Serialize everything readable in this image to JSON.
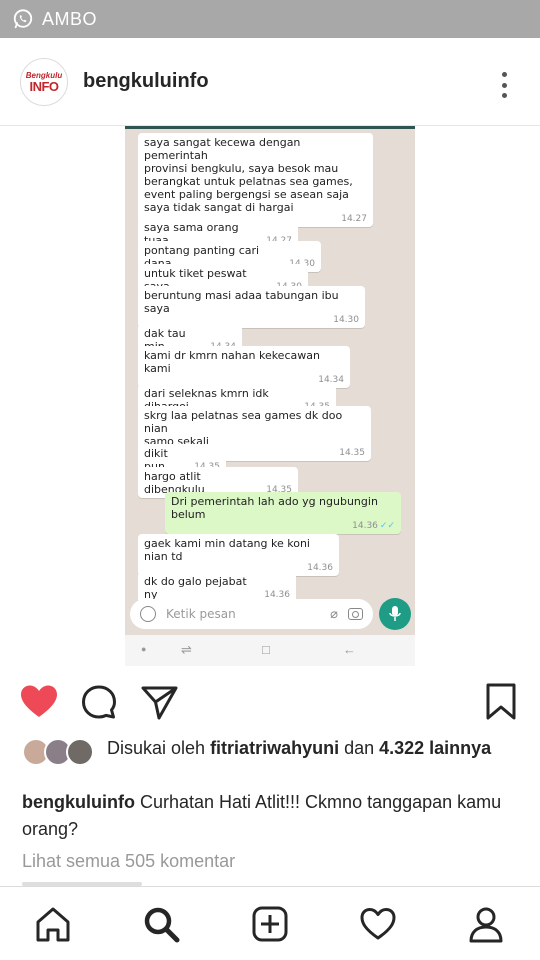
{
  "status_bar": {
    "app_name": "AMBO",
    "icon": "whatsapp-icon"
  },
  "post": {
    "username": "bengkuluinfo",
    "avatar_logo_top": "Bengkulu",
    "avatar_logo_bottom": "INFO",
    "more_icon": "more-vertical-icon"
  },
  "chat": {
    "messages": [
      {
        "text": "saya sangat kecewa dengan pemerintah\nprovinsi bengkulu, saya besok mau\nberangkat untuk pelatnas sea games,\nevent paling bergengsi se asean saja\nsaya tidak sangat di hargai",
        "time": "14.27",
        "outgoing": false
      },
      {
        "text": "saya sama orang tuaa",
        "time": "14.27",
        "outgoing": false
      },
      {
        "text": "pontang panting cari dana",
        "time": "14.30",
        "outgoing": false
      },
      {
        "text": "untuk tiket peswat saya",
        "time": "14.30",
        "outgoing": false
      },
      {
        "text": "beruntung masi adaa tabungan ibu saya",
        "time": "14.30",
        "outgoing": false
      },
      {
        "text": "dak tau min",
        "time": "14.34",
        "outgoing": false
      },
      {
        "text": "kami dr kmrn nahan kekecawan kami",
        "time": "14.34",
        "outgoing": false
      },
      {
        "text": "dari seleknas kmrn idk dihargoi",
        "time": "14.35",
        "outgoing": false
      },
      {
        "text": "skrg laa pelatnas sea games dk doo nian\nsamo sekali",
        "time": "14.35",
        "outgoing": false
      },
      {
        "text": "dikit pun",
        "time": "14.35",
        "outgoing": false
      },
      {
        "text": "hargo atlit dibengkulu",
        "time": "14.35",
        "outgoing": false
      },
      {
        "text": "Dri pemerintah lah ado yg ngubungin\nbelum",
        "time": "14.36",
        "outgoing": true
      },
      {
        "text": "gaek kami min datang ke koni nian td",
        "time": "14.36",
        "outgoing": false
      },
      {
        "text": "dk do galo pejabat ny",
        "time": "14.36",
        "outgoing": false
      }
    ],
    "input_placeholder": "Ketik pesan",
    "ticks": "✓✓"
  },
  "actions": {
    "like_icon": "heart-filled-icon",
    "comment_icon": "comment-icon",
    "share_icon": "send-icon",
    "save_icon": "bookmark-icon",
    "like_color": "#ed4956"
  },
  "likes": {
    "prefix": "Disukai oleh ",
    "user": "fitriatriwahyuni",
    "middle": " dan ",
    "count": "4.322",
    "suffix": " lainnya"
  },
  "caption": {
    "username": "bengkuluinfo",
    "text": " Curhatan Hati Atlit!!! Ckmno tanggapan kamu orang?"
  },
  "comments_link": "Lihat semua 505 komentar",
  "bottom_nav": [
    "home-icon",
    "search-icon",
    "add-post-icon",
    "activity-heart-icon",
    "profile-icon"
  ]
}
